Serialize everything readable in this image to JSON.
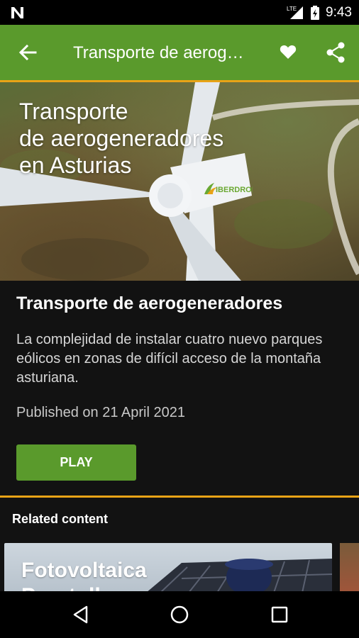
{
  "status_bar": {
    "time": "9:43",
    "network": "LTE",
    "icons": [
      "notification-n-icon",
      "signal-icon",
      "battery-charging-icon"
    ]
  },
  "app_bar": {
    "title": "Transporte de aerogeneradores",
    "back_icon": "arrow-left-icon",
    "favorite_icon": "heart-icon",
    "share_icon": "share-icon"
  },
  "hero": {
    "lines": [
      "Transporte",
      "de aerogeneradores",
      "en Asturias"
    ],
    "brand": "IBERDROLA"
  },
  "article": {
    "title": "Transporte de aerogeneradores",
    "description": "La complejidad de instalar cuatro nuevo parques eólicos en zonas de difícil acceso de la montaña asturiana.",
    "published": "Published on 21 April 2021",
    "play_label": "PLAY"
  },
  "related": {
    "heading": "Related content",
    "cards": [
      {
        "title_line1": "Fotovoltaica",
        "title_line2": "Puertollano"
      }
    ]
  },
  "colors": {
    "brand_green": "#5a9a2c",
    "accent_orange": "#e8a317",
    "background": "#121212"
  },
  "nav_bar": {
    "icons": [
      "nav-back-icon",
      "nav-home-icon",
      "nav-recents-icon"
    ]
  }
}
